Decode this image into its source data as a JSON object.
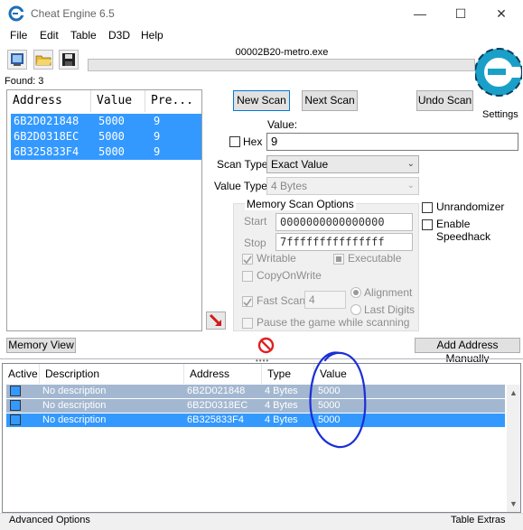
{
  "window": {
    "title": "Cheat Engine 6.5",
    "minimize_icon": "minimize-icon",
    "maximize_icon": "maximize-icon",
    "close_icon": "close-icon"
  },
  "menu": [
    "File",
    "Edit",
    "Table",
    "D3D",
    "Help"
  ],
  "toolbar": {
    "process_name": "00002B20-metro.exe",
    "found_label": "Found: 3",
    "icons": [
      "open-process-icon",
      "open-file-icon",
      "save-icon"
    ],
    "settings_label": "Settings"
  },
  "results": {
    "columns": [
      "Address",
      "Value",
      "Pre..."
    ],
    "rows": [
      {
        "address": "6B2D021848",
        "value": "5000",
        "previous": "9"
      },
      {
        "address": "6B2D0318EC",
        "value": "5000",
        "previous": "9"
      },
      {
        "address": "6B325833F4",
        "value": "5000",
        "previous": "9"
      }
    ]
  },
  "scan": {
    "new_scan": "New Scan",
    "next_scan": "Next Scan",
    "undo_scan": "Undo Scan",
    "value_label": "Value:",
    "hex_label": "Hex",
    "value_input": "9",
    "scan_type_label": "Scan Type",
    "scan_type_value": "Exact Value",
    "value_type_label": "Value Type",
    "value_type_value": "4 Bytes"
  },
  "memory_options": {
    "title": "Memory Scan Options",
    "start_label": "Start",
    "start_value": "0000000000000000",
    "stop_label": "Stop",
    "stop_value": "7fffffffffffffff",
    "writable": "Writable",
    "executable": "Executable",
    "copy_on_write": "CopyOnWrite",
    "fast_scan": "Fast Scan",
    "fast_scan_value": "4",
    "alignment": "Alignment",
    "last_digits": "Last Digits",
    "pause_game": "Pause the game while scanning"
  },
  "extras": {
    "unrandomizer": "Unrandomizer",
    "enable_speedhack": "Enable Speedhack"
  },
  "bottom_buttons": {
    "memory_view": "Memory View",
    "add_address_manually": "Add Address Manually"
  },
  "address_table": {
    "columns": [
      "Active",
      "Description",
      "Address",
      "Type",
      "Value"
    ],
    "rows": [
      {
        "description": "No description",
        "address": "6B2D021848",
        "type": "4 Bytes",
        "value": "5000"
      },
      {
        "description": "No description",
        "address": "6B2D0318EC",
        "type": "4 Bytes",
        "value": "5000"
      },
      {
        "description": "No description",
        "address": "6B325833F4",
        "type": "4 Bytes",
        "value": "5000"
      }
    ]
  },
  "status": {
    "advanced_options": "Advanced Options",
    "table_extras": "Table Extras"
  },
  "colors": {
    "selection_blue": "#3399ff",
    "muted_row": "#a3b7d0",
    "annotation_circle": "#1a2fd6",
    "stop_red": "#e02020"
  }
}
